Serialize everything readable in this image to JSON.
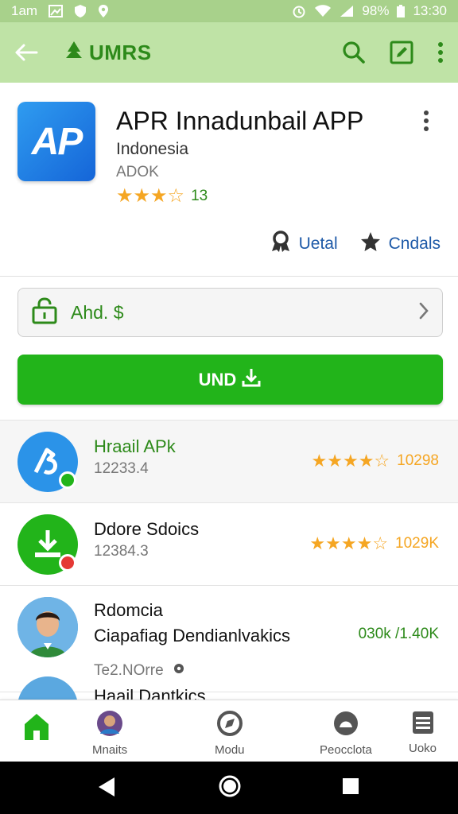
{
  "status_bar": {
    "time_left": "1am",
    "battery": "98%",
    "clock": "13:30"
  },
  "app_bar": {
    "title": "UMRS"
  },
  "app": {
    "logo_text": "AP",
    "name": "APR Innadunbail APP",
    "developer": "Indonesia",
    "category": "ADOK",
    "stars": "★★★☆",
    "rating_count": "13",
    "action_1": "Uetal",
    "action_2": "Cndals"
  },
  "price": {
    "label": "Ahd. $"
  },
  "install": {
    "label": "UND"
  },
  "list": [
    {
      "title": "Hraail APk",
      "subtitle": "12233.4",
      "stars": "★★★★☆",
      "value": "10298",
      "title_color": "#2d8a1a"
    },
    {
      "title": "Ddore Sdoics",
      "subtitle": "12384.3",
      "stars": "★★★★☆",
      "value": "1029K",
      "title_color": "#111111"
    },
    {
      "title_1": "Rdomcia",
      "title_2": "Ciapafiag Dendianlvakics",
      "subtitle": "Te2.NOrre",
      "value": "030k /1.40K"
    },
    {
      "title": "Haail Dantkics"
    }
  ],
  "bottom_nav": [
    {
      "label": ""
    },
    {
      "label": "Mnaits"
    },
    {
      "label": "Modu"
    },
    {
      "label": "Peocclota"
    },
    {
      "label": "Uoko"
    }
  ],
  "colors": {
    "accent_green": "#22b41a",
    "app_bar": "#bfe3a6",
    "status_bar": "#a8d18b",
    "star": "#f5a623",
    "link": "#1e5aa8"
  }
}
